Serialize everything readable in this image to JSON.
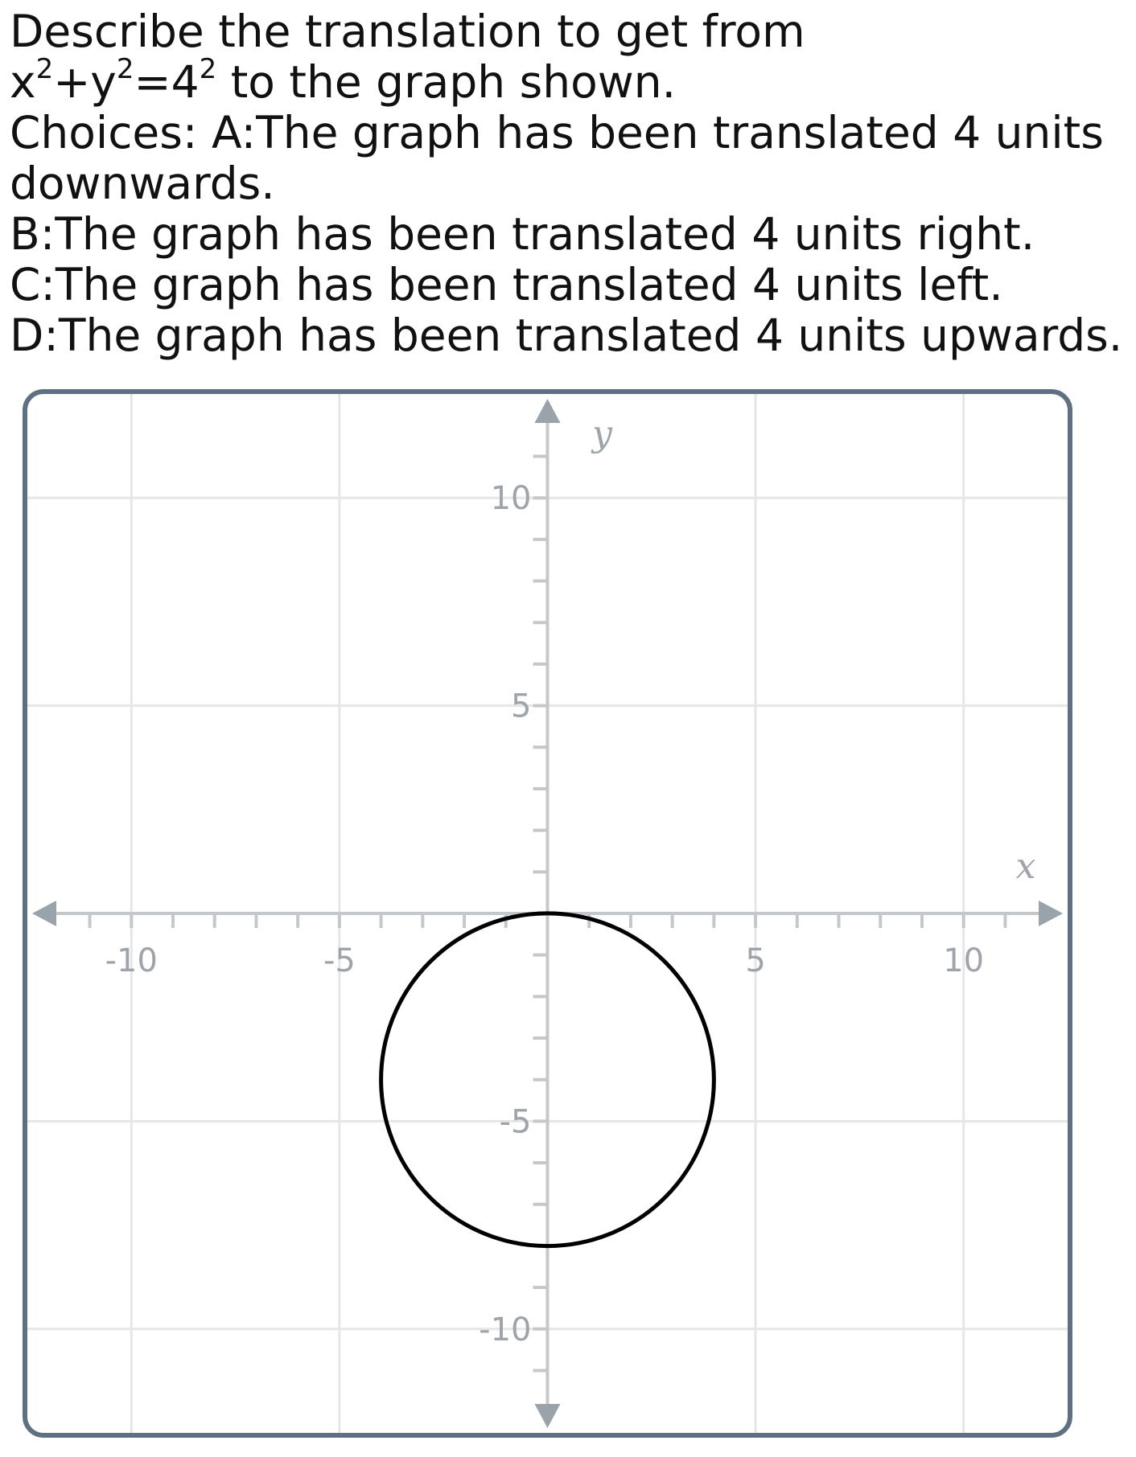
{
  "question": {
    "line1": "Describe the translation to get from",
    "equation": {
      "x_base": "x",
      "x_exp": "2",
      "plus": "+",
      "y_base": "y",
      "y_exp": "2",
      "equals": "=",
      "r_base": "4",
      "r_exp": "2",
      "tail": " to the graph shown."
    },
    "choices_prefix": "Choices: ",
    "choices": [
      "A:The graph has been translated 4 units downwards.",
      "B:The graph has been translated 4 units right.",
      "C:The graph has been translated 4 units left.",
      "D:The graph has been translated 4 units upwards."
    ]
  },
  "graph": {
    "x_axis_label": "x",
    "y_axis_label": "y",
    "x_range": [
      -12.5,
      12.5
    ],
    "y_range": [
      -12.5,
      12.5
    ],
    "minor_tick_step": 1,
    "gridline_step": 5,
    "x_tick_labels": [
      {
        "value": -10,
        "text": "-10"
      },
      {
        "value": -5,
        "text": "-5"
      },
      {
        "value": 5,
        "text": "5"
      },
      {
        "value": 10,
        "text": "10"
      }
    ],
    "y_tick_labels": [
      {
        "value": 10,
        "text": "10"
      },
      {
        "value": 5,
        "text": "5"
      },
      {
        "value": -5,
        "text": "-5"
      },
      {
        "value": -10,
        "text": "-10"
      }
    ],
    "circle": {
      "center": [
        0,
        -4
      ],
      "radius": 4
    },
    "colors": {
      "frame": "#5e7081",
      "grid": "#e4e6e8",
      "axis": "#c4c8cb",
      "arrow": "#9aa3aa",
      "labels": "#9ea4aa",
      "curve": "#000000"
    }
  }
}
